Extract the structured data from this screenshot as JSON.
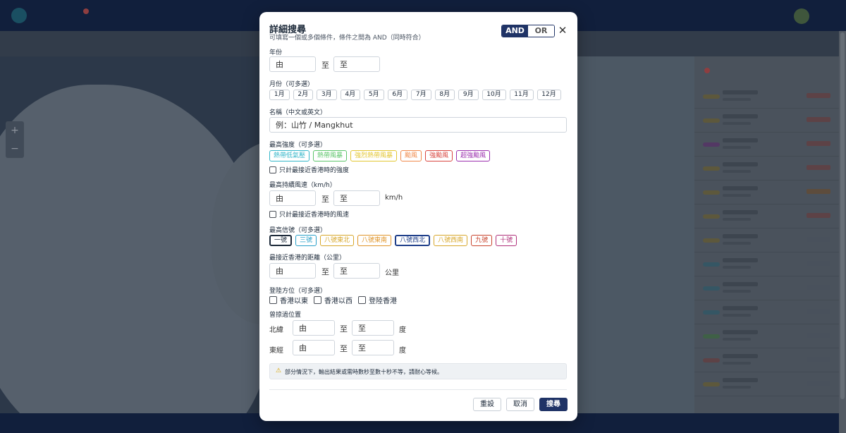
{
  "modal": {
    "title": "詳細搜尋",
    "subtitle": "可填寫一個或多個條件，條件之間為 AND（同時符合）",
    "mode": {
      "and": "AND",
      "or": "OR"
    },
    "close_icon": "✕",
    "year": {
      "label": "年份",
      "from_placeholder": "由",
      "to_text": "至",
      "to_placeholder": "至"
    },
    "month": {
      "label": "月份（可多選）",
      "options": [
        "1月",
        "2月",
        "3月",
        "4月",
        "5月",
        "6月",
        "7月",
        "8月",
        "9月",
        "10月",
        "11月",
        "12月"
      ]
    },
    "name": {
      "label": "名稱（中文或英文）",
      "placeholder": "例：山竹 / Mangkhut"
    },
    "intensity": {
      "label": "最高強度（可多選）",
      "options": [
        {
          "label": "熱帶低氣壓",
          "color": "#33b6c9"
        },
        {
          "label": "熱帶風暴",
          "color": "#5cc46a"
        },
        {
          "label": "強烈熱帶風暴",
          "color": "#e3c631"
        },
        {
          "label": "颱風",
          "color": "#f08a4b"
        },
        {
          "label": "強颱風",
          "color": "#d8453f"
        },
        {
          "label": "超強颱風",
          "color": "#9b2fae"
        }
      ],
      "closest_only": "只計最接近香港時的強度"
    },
    "wind": {
      "label": "最高持續風速（km/h）",
      "from_placeholder": "由",
      "to_text": "至",
      "to_placeholder": "至",
      "unit": "km/h",
      "closest_only": "只計最接近香港時的風速"
    },
    "signal": {
      "label": "最高信號（可多選）",
      "options": [
        {
          "label": "一號",
          "color": "#1d2a3a"
        },
        {
          "label": "三號",
          "color": "#2aa0c9"
        },
        {
          "label": "八號東北",
          "color": "#d8a72a"
        },
        {
          "label": "八號東南",
          "color": "#e0952a"
        },
        {
          "label": "八號西北",
          "color": "#1f3f8a"
        },
        {
          "label": "八號西南",
          "color": "#d8a72a"
        },
        {
          "label": "九號",
          "color": "#c9452e"
        },
        {
          "label": "十號",
          "color": "#b0307a"
        }
      ]
    },
    "distance": {
      "label": "最接近香港的距離（公里）",
      "from_placeholder": "由",
      "to_text": "至",
      "to_placeholder": "至",
      "unit": "公里"
    },
    "landfall": {
      "label": "登陸方位（可多選）",
      "options": [
        "香港以東",
        "香港以西",
        "登陸香港"
      ]
    },
    "passed": {
      "label": "曾掠過位置",
      "lat": {
        "label": "北緯",
        "from_placeholder": "由",
        "to_text": "至",
        "to_placeholder": "至",
        "unit": "度"
      },
      "lon": {
        "label": "東經",
        "from_placeholder": "由",
        "to_text": "至",
        "to_placeholder": "至",
        "unit": "度"
      }
    },
    "note": {
      "icon": "⚠",
      "text": "部分情況下，輸出結果或需時數秒至數十秒不等，請耐心等候。"
    },
    "buttons": {
      "reset": "重設",
      "cancel": "取消",
      "search": "搜尋"
    }
  },
  "background": {
    "zoom_in": "+",
    "zoom_out": "−"
  }
}
